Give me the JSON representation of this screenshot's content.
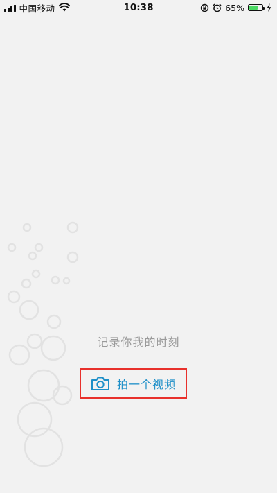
{
  "status_bar": {
    "carrier": "中国移动",
    "time": "10:38",
    "battery_percent": "65%",
    "battery_level": 0.65,
    "icons": [
      "signal-icon",
      "wifi-icon",
      "orientation-lock-icon",
      "alarm-icon",
      "battery-icon",
      "charging-icon"
    ]
  },
  "main": {
    "tagline": "记录你我的时刻",
    "take_video_label": "拍一个视频",
    "button_icon": "camera-icon"
  },
  "colors": {
    "background": "#f2f2f2",
    "accent": "#1d8fc8",
    "highlight_border": "#e8312c",
    "tagline": "#9a9a9a"
  }
}
